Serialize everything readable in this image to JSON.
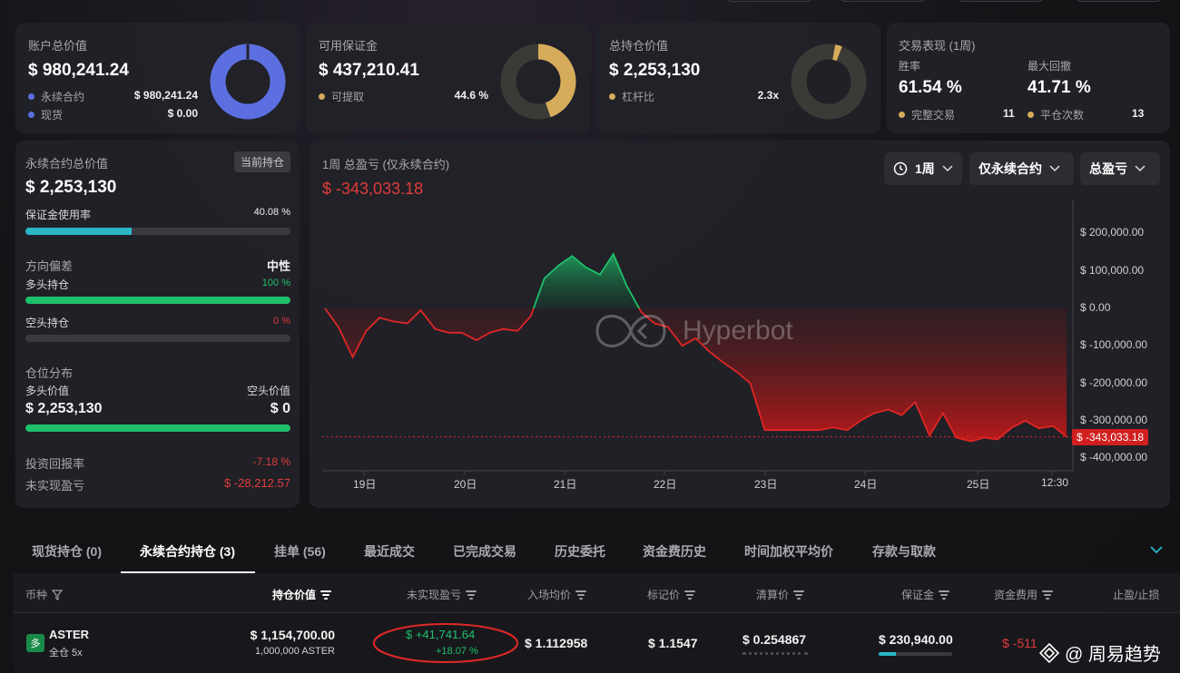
{
  "colors": {
    "accent_blue": "#5b6fe0",
    "gold": "#d6ac5b",
    "green": "#1ec06b",
    "red": "#e23b3b",
    "teal": "#2ab7c8"
  },
  "account": {
    "title": "账户总价值",
    "value": "$ 980,241.24",
    "rows": [
      {
        "label": "永续合约",
        "value": "$ 980,241.24"
      },
      {
        "label": "现货",
        "value": "$ 0.00"
      }
    ],
    "donut_fraction": 1.0
  },
  "margin": {
    "title": "可用保证金",
    "value": "$ 437,210.41",
    "row_label": "可提取",
    "row_value": "44.6 %",
    "donut_fraction": 0.446
  },
  "position": {
    "title": "总持仓价值",
    "value": "$ 2,253,130",
    "row_label": "杠杆比",
    "row_value": "2.3x",
    "donut_fraction": 0.03
  },
  "perf": {
    "title": "交易表现 (1周)",
    "win_label": "胜率",
    "win_value": "61.54 %",
    "dd_label": "最大回撤",
    "dd_value": "41.71 %",
    "done_label": "完整交易",
    "done_value": "11",
    "close_label": "平仓次数",
    "close_value": "13"
  },
  "left": {
    "perp_title": "永续合约总价值",
    "perp_badge": "当前持仓",
    "perp_value": "$ 2,253,130",
    "margin_rate_label": "保证金使用率",
    "margin_rate_value": "40.08 %",
    "margin_rate_fraction": 0.4008,
    "bias_label": "方向偏差",
    "bias_value": "中性",
    "long_label": "多头持仓",
    "long_value": "100 %",
    "long_fraction": 1.0,
    "short_label": "空头持仓",
    "short_value": "0 %",
    "short_fraction": 0.0,
    "dist_label": "仓位分布",
    "long_val_label": "多头价值",
    "short_val_label": "空头价值",
    "long_val": "$ 2,253,130",
    "short_val": "$ 0",
    "roi_label": "投资回报率",
    "roi_value": "-7.18 %",
    "upnl_label": "未实现盈亏",
    "upnl_value": "$ -28,212.57"
  },
  "chart_panel": {
    "title": "1周 总盈亏 (仅永续合约)",
    "value": "$ -343,033.18",
    "dd1": "1周",
    "dd2": "仅永续合约",
    "dd3": "总盈亏",
    "watermark": "Hyperbot",
    "last_label": "$ -343,033.18"
  },
  "chart_data": {
    "type": "area",
    "title": "1周 总盈亏 (仅永续合约)",
    "x_ticks": [
      "19日",
      "20日",
      "21日",
      "22日",
      "23日",
      "24日",
      "25日",
      "12:30"
    ],
    "y_ticks": [
      "$ 200,000.00",
      "$ 100,000.00",
      "$ 0.00",
      "$ -100,000.00",
      "$ -200,000.00",
      "$ -300,000.00",
      "$ -400,000.00"
    ],
    "ylim": [
      -420000,
      230000
    ],
    "x": [
      0,
      0.13,
      0.27,
      0.4,
      0.53,
      0.67,
      0.8,
      0.93,
      1.07,
      1.2,
      1.33,
      1.47,
      1.6,
      1.73,
      1.87,
      2.0,
      2.13,
      2.27,
      2.4,
      2.53,
      2.67,
      2.8,
      2.93,
      3.07,
      3.2,
      3.33,
      3.47,
      3.6,
      3.73,
      3.87,
      4.0,
      4.13,
      4.27,
      4.4,
      4.53,
      4.67,
      4.8,
      4.93,
      5.07,
      5.2,
      5.33,
      5.47,
      5.6,
      5.73,
      5.87,
      6.0,
      6.13,
      6.27,
      6.4,
      6.53,
      6.67,
      6.8,
      6.93,
      7.07,
      7.2
    ],
    "values": [
      0,
      -50000,
      -130000,
      -60000,
      -25000,
      -35000,
      -40000,
      -5000,
      -55000,
      -65000,
      -65000,
      -85000,
      -65000,
      -55000,
      -60000,
      -20000,
      80000,
      115000,
      140000,
      110000,
      90000,
      145000,
      60000,
      -10000,
      -40000,
      -50000,
      -100000,
      -80000,
      -115000,
      -145000,
      -170000,
      -200000,
      -325000,
      -325000,
      -325000,
      -325000,
      -325000,
      -318000,
      -325000,
      -300000,
      -280000,
      -270000,
      -285000,
      -250000,
      -340000,
      -280000,
      -345000,
      -355000,
      -345000,
      -350000,
      -318000,
      -300000,
      -320000,
      -314000,
      -343033
    ],
    "last_value": -343033.18
  },
  "tabs": [
    "现货持仓 (0)",
    "永续合约持仓 (3)",
    "挂单 (56)",
    "最近成交",
    "已完成交易",
    "历史委托",
    "资金费历史",
    "时间加权平均价",
    "存款与取款"
  ],
  "active_tab": 1,
  "table": {
    "headers": [
      "币种",
      "持仓价值",
      "未实现盈亏",
      "入场均价",
      "标记价",
      "清算价",
      "保证金",
      "资金费用",
      "止盈/止损"
    ],
    "row": {
      "coin": "ASTER",
      "coin_icon_text": "多",
      "mode": "全仓 5x",
      "value": "$ 1,154,700.00",
      "qty": "1,000,000 ASTER",
      "upnl": "$ +41,741.64",
      "upnl_pct": "+18.07 %",
      "entry": "$ 1.112958",
      "mark": "$ 1.1547",
      "liq": "$ 0.254867",
      "margin": "$ 230,940.00",
      "funding": "$ -511"
    }
  },
  "watermark_brand": "@ 周易趋势"
}
